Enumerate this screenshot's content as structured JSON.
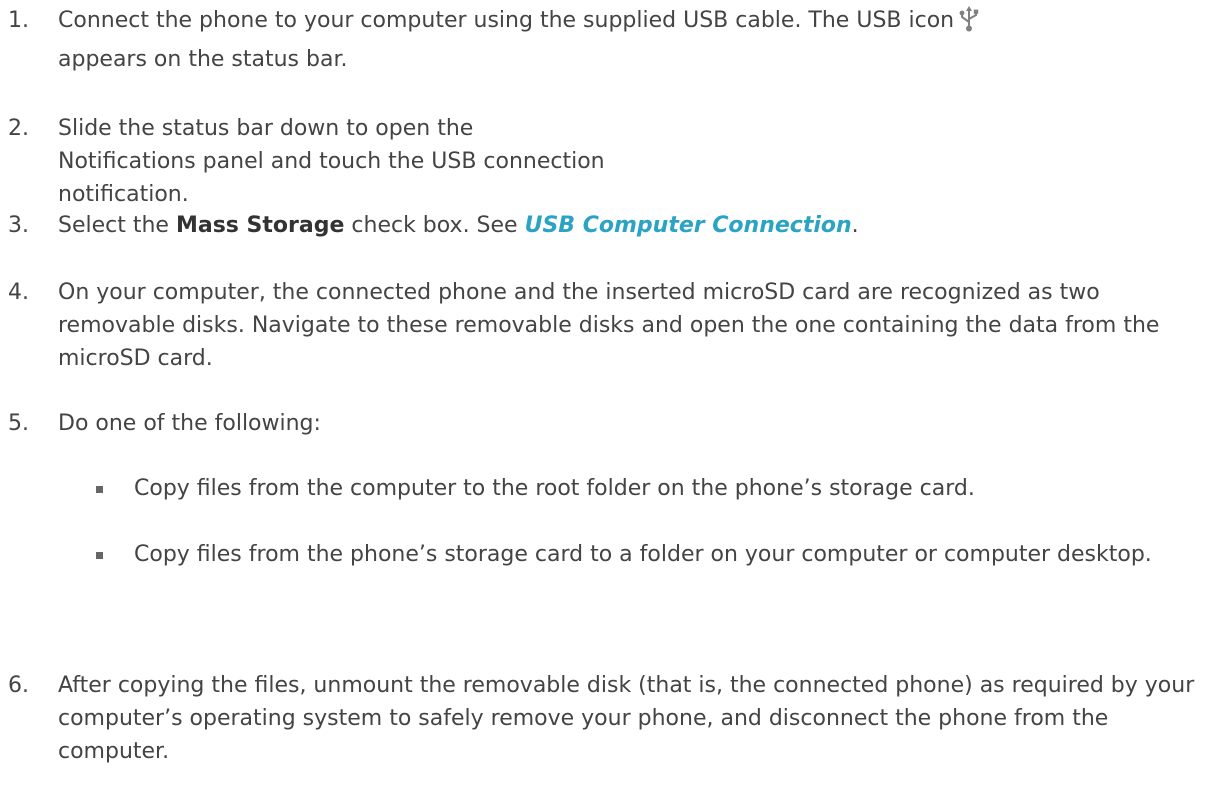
{
  "steps": [
    {
      "num": "1.",
      "text_before_icon": "Connect the phone to your computer using the supplied USB cable. The USB icon",
      "text_after_icon": "appears on the status bar.",
      "icon": "usb-icon"
    },
    {
      "num": "2.",
      "text": "Slide the status bar down to open the Notifications panel and touch the USB connection notification."
    },
    {
      "num": "3.",
      "text_before": "Select the ",
      "bold": "Mass Storage",
      "text_middle": " check box. See ",
      "link": "USB Computer Connection",
      "text_after": "."
    },
    {
      "num": "4.",
      "text": "On your computer, the connected phone and the inserted microSD card are recognized as two removable disks. Navigate to these removable disks and open the one containing the data from the microSD card."
    },
    {
      "num": "5.",
      "text": "Do one of the following:",
      "subitems": [
        "Copy files from the computer to the root folder on the phone’s storage card.",
        "Copy files from the phone’s storage card to a folder on your computer or computer desktop."
      ]
    },
    {
      "num": "6.",
      "text": "After copying the files, unmount the removable disk (that is, the connected phone) as required by your computer’s operating system to safely remove your phone, and disconnect the phone from the computer."
    }
  ],
  "colors": {
    "text": "#444444",
    "link": "#2aa3c4",
    "icon": "#808080"
  }
}
